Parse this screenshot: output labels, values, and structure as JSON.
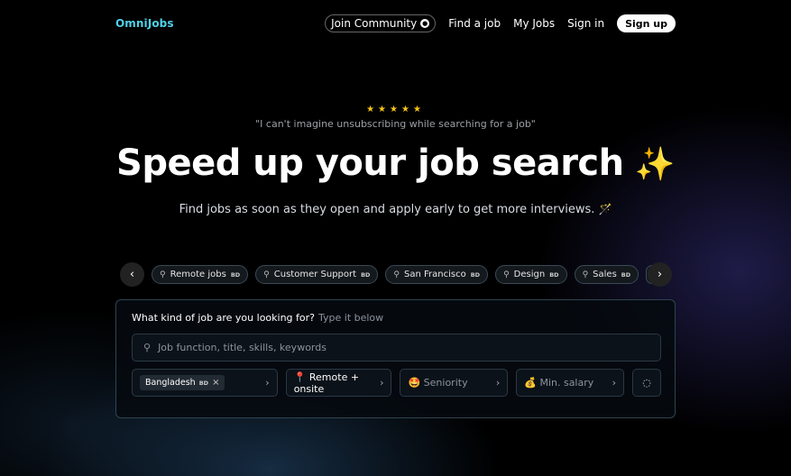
{
  "nav": {
    "logo": "OmniJobs",
    "join_community": "Join Community",
    "find_job": "Find a job",
    "my_jobs": "My Jobs",
    "sign_in": "Sign in",
    "sign_up": "Sign up"
  },
  "hero": {
    "stars": "★★★★★",
    "quote": "\"I can't imagine unsubscribing while searching for a job\"",
    "headline": "Speed up your job search",
    "sparkle": "✨",
    "subtitle": "Find jobs as soon as they open and apply early to get more interviews.",
    "wand": "🪄"
  },
  "chips": [
    {
      "label": "Remote jobs",
      "badge": "BD"
    },
    {
      "label": "Customer Support",
      "badge": "BD"
    },
    {
      "label": "San Francisco",
      "badge": "BD"
    },
    {
      "label": "Design",
      "badge": "BD"
    },
    {
      "label": "Sales",
      "badge": "BD"
    }
  ],
  "panel": {
    "question": "What kind of job are you looking for?",
    "hint": "Type it below",
    "search_placeholder": "Job function, title, skills, keywords",
    "location_tag": "Bangladesh",
    "location_badge": "BD",
    "remote": "Remote + onsite",
    "remote_icon": "📍",
    "seniority": "Seniority",
    "seniority_icon": "🤩",
    "salary": "Min. salary",
    "salary_icon": "💰"
  },
  "icons": {
    "search": "⚲",
    "prev": "‹",
    "next": "›",
    "close": "×",
    "chevron": "›",
    "eye_off": "◌"
  },
  "colors": {
    "brand": "#4fd1e8",
    "star": "#f5c518"
  }
}
